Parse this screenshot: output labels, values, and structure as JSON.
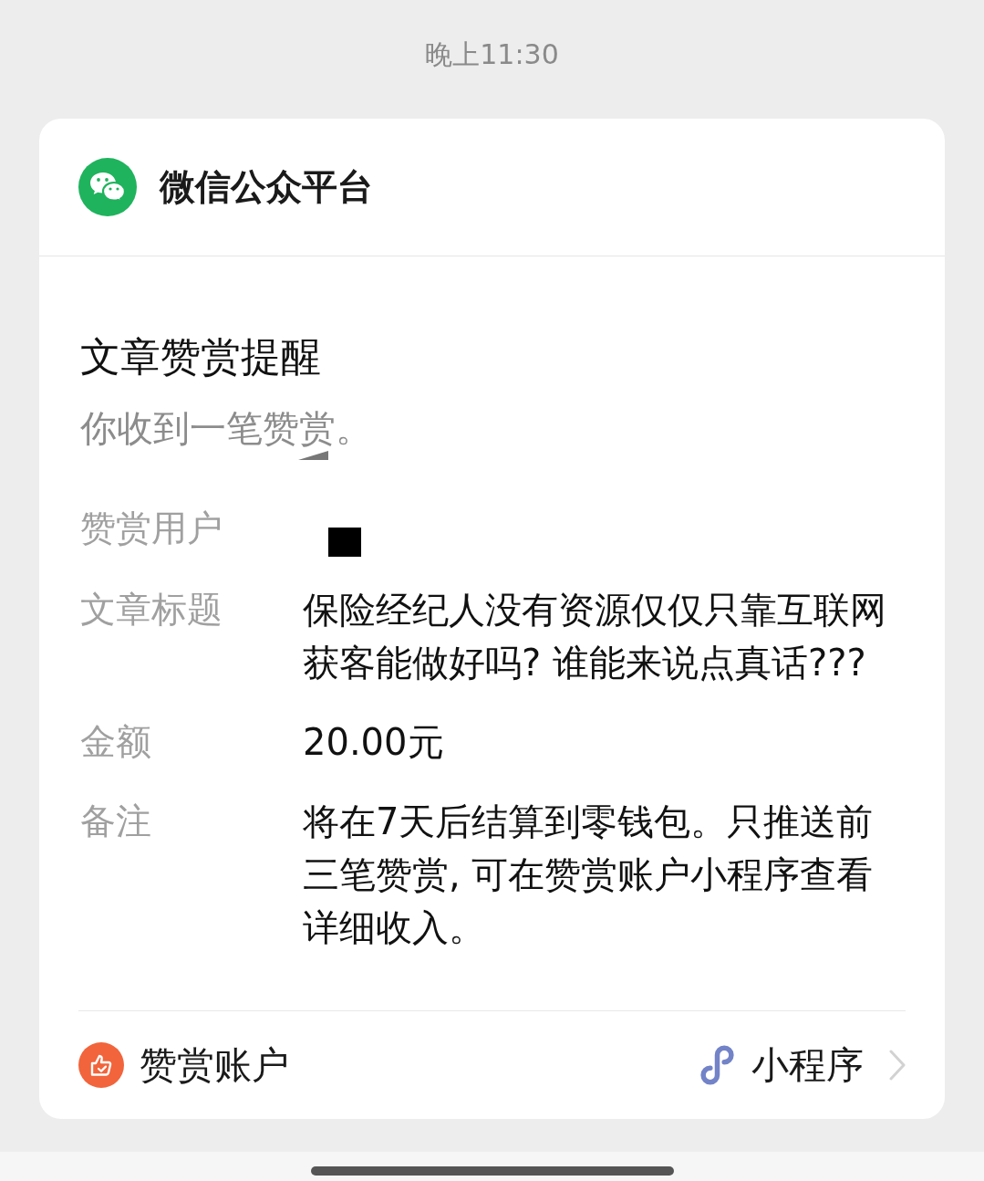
{
  "status": {
    "time": "晚上11:30"
  },
  "card": {
    "header": {
      "name": "微信公众平台"
    },
    "title": "文章赞赏提醒",
    "subtitle": "你收到一笔赞赏。",
    "fields": [
      {
        "label": "赞赏用户",
        "kind": "redacted"
      },
      {
        "label": "文章标题",
        "kind": "text",
        "value": "保险经纪人没有资源仅仅只靠互联网获客能做好吗? 谁能来说点真话???"
      },
      {
        "label": "金额",
        "kind": "text",
        "value": "20.00元"
      },
      {
        "label": "备注",
        "kind": "text",
        "value": "将在7天后结算到零钱包。只推送前三笔赞赏, 可在赞赏账户小程序查看详细收入。"
      }
    ],
    "footer": {
      "account": "赞赏账户",
      "app_type": "小程序"
    }
  }
}
